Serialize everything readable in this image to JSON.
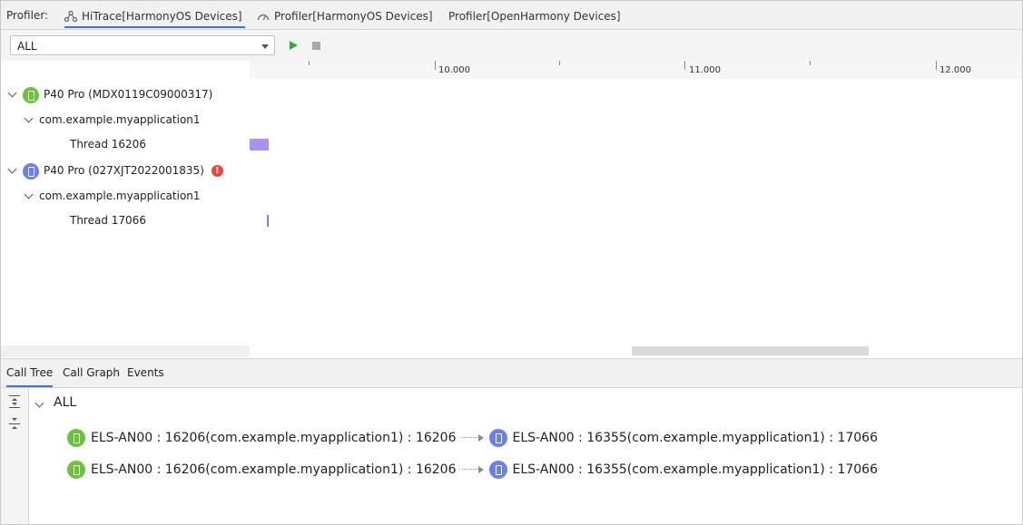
{
  "header": {
    "label": "Profiler:",
    "tabs": [
      {
        "label": "HiTrace[HarmonyOS Devices]",
        "icon": "hitrace-icon",
        "active": true
      },
      {
        "label": "Profiler[HarmonyOS Devices]",
        "icon": "gauge-icon",
        "active": false
      },
      {
        "label": "Profiler[OpenHarmony Devices]",
        "icon": "",
        "active": false
      }
    ]
  },
  "toolbar": {
    "filter_value": "ALL",
    "play_icon": "play-icon",
    "stop_icon": "stop-icon"
  },
  "tree": {
    "devices": [
      {
        "name": "P40 Pro (MDX0119C09000317)",
        "icon_color": "#6cc33b",
        "app": "com.example.myapplication1",
        "thread": "Thread 16206",
        "error": false
      },
      {
        "name": "P40 Pro (027XJT2022001835)",
        "icon_color": "#6a7ff0",
        "app": "com.example.myapplication1",
        "thread": "Thread 17066",
        "error": true,
        "error_mark": "!"
      }
    ]
  },
  "timeline": {
    "ticks": [
      "10.000",
      "11.000",
      "12.000"
    ],
    "bar_color": "#a893f1"
  },
  "bottom": {
    "tabs": [
      {
        "label": "Call Tree",
        "active": true
      },
      {
        "label": "Call Graph",
        "active": false
      },
      {
        "label": "Events",
        "active": false
      }
    ],
    "root": "ALL",
    "rows": [
      {
        "from": "ELS-AN00 : 16206(com.example.myapplication1) : 16206",
        "to": "ELS-AN00 : 16355(com.example.myapplication1) : 17066"
      },
      {
        "from": "ELS-AN00 : 16206(com.example.myapplication1) : 16206",
        "to": "ELS-AN00 : 16355(com.example.myapplication1) : 17066"
      }
    ]
  }
}
